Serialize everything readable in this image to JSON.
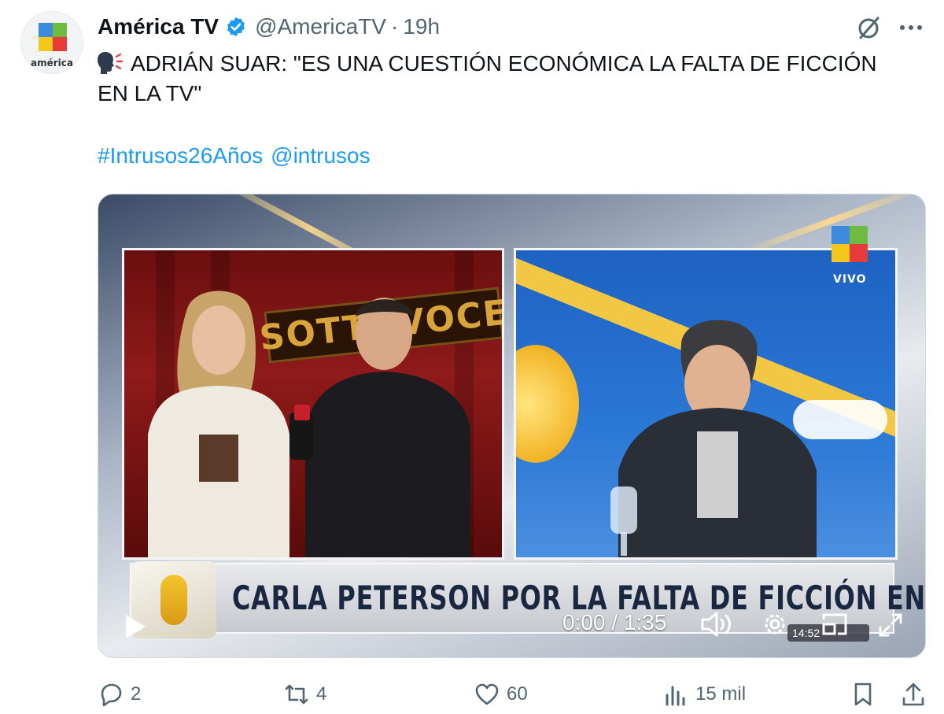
{
  "author": {
    "avatar_text": "américa",
    "name": "América TV",
    "handle": "@AmericaTV",
    "separator": "·",
    "time": "19h"
  },
  "tweet": {
    "text_line1": "ADRIÁN SUAR: \"ES UNA CUESTIÓN ECONÓMICA LA FALTA DE FICCIÓN",
    "text_line2": "EN LA TV\"",
    "hashtag": "#Intrusos26Años",
    "mention": "@intrusos"
  },
  "video": {
    "set_sign": "SOTTOVOCE",
    "live_label": "VIVO",
    "lower_third": "CARLA PETERSON POR LA FALTA DE FICCIÓN EN LA TV",
    "timecode": "0:00 / 1:35",
    "clock": "14:52"
  },
  "actions": {
    "replies": "2",
    "reposts": "4",
    "likes": "60",
    "views": "15 mil"
  },
  "icons": [
    "verified-badge-icon",
    "grok-icon",
    "more-icon",
    "speaking-head-icon",
    "play-icon",
    "volume-icon",
    "settings-gear-icon",
    "picture-in-picture-icon",
    "fullscreen-icon",
    "reply-icon",
    "repost-icon",
    "like-icon",
    "views-icon",
    "bookmark-icon",
    "share-icon"
  ],
  "colors": {
    "accent": "#1d9bf0",
    "muted": "#536471",
    "text": "#0f1419"
  }
}
